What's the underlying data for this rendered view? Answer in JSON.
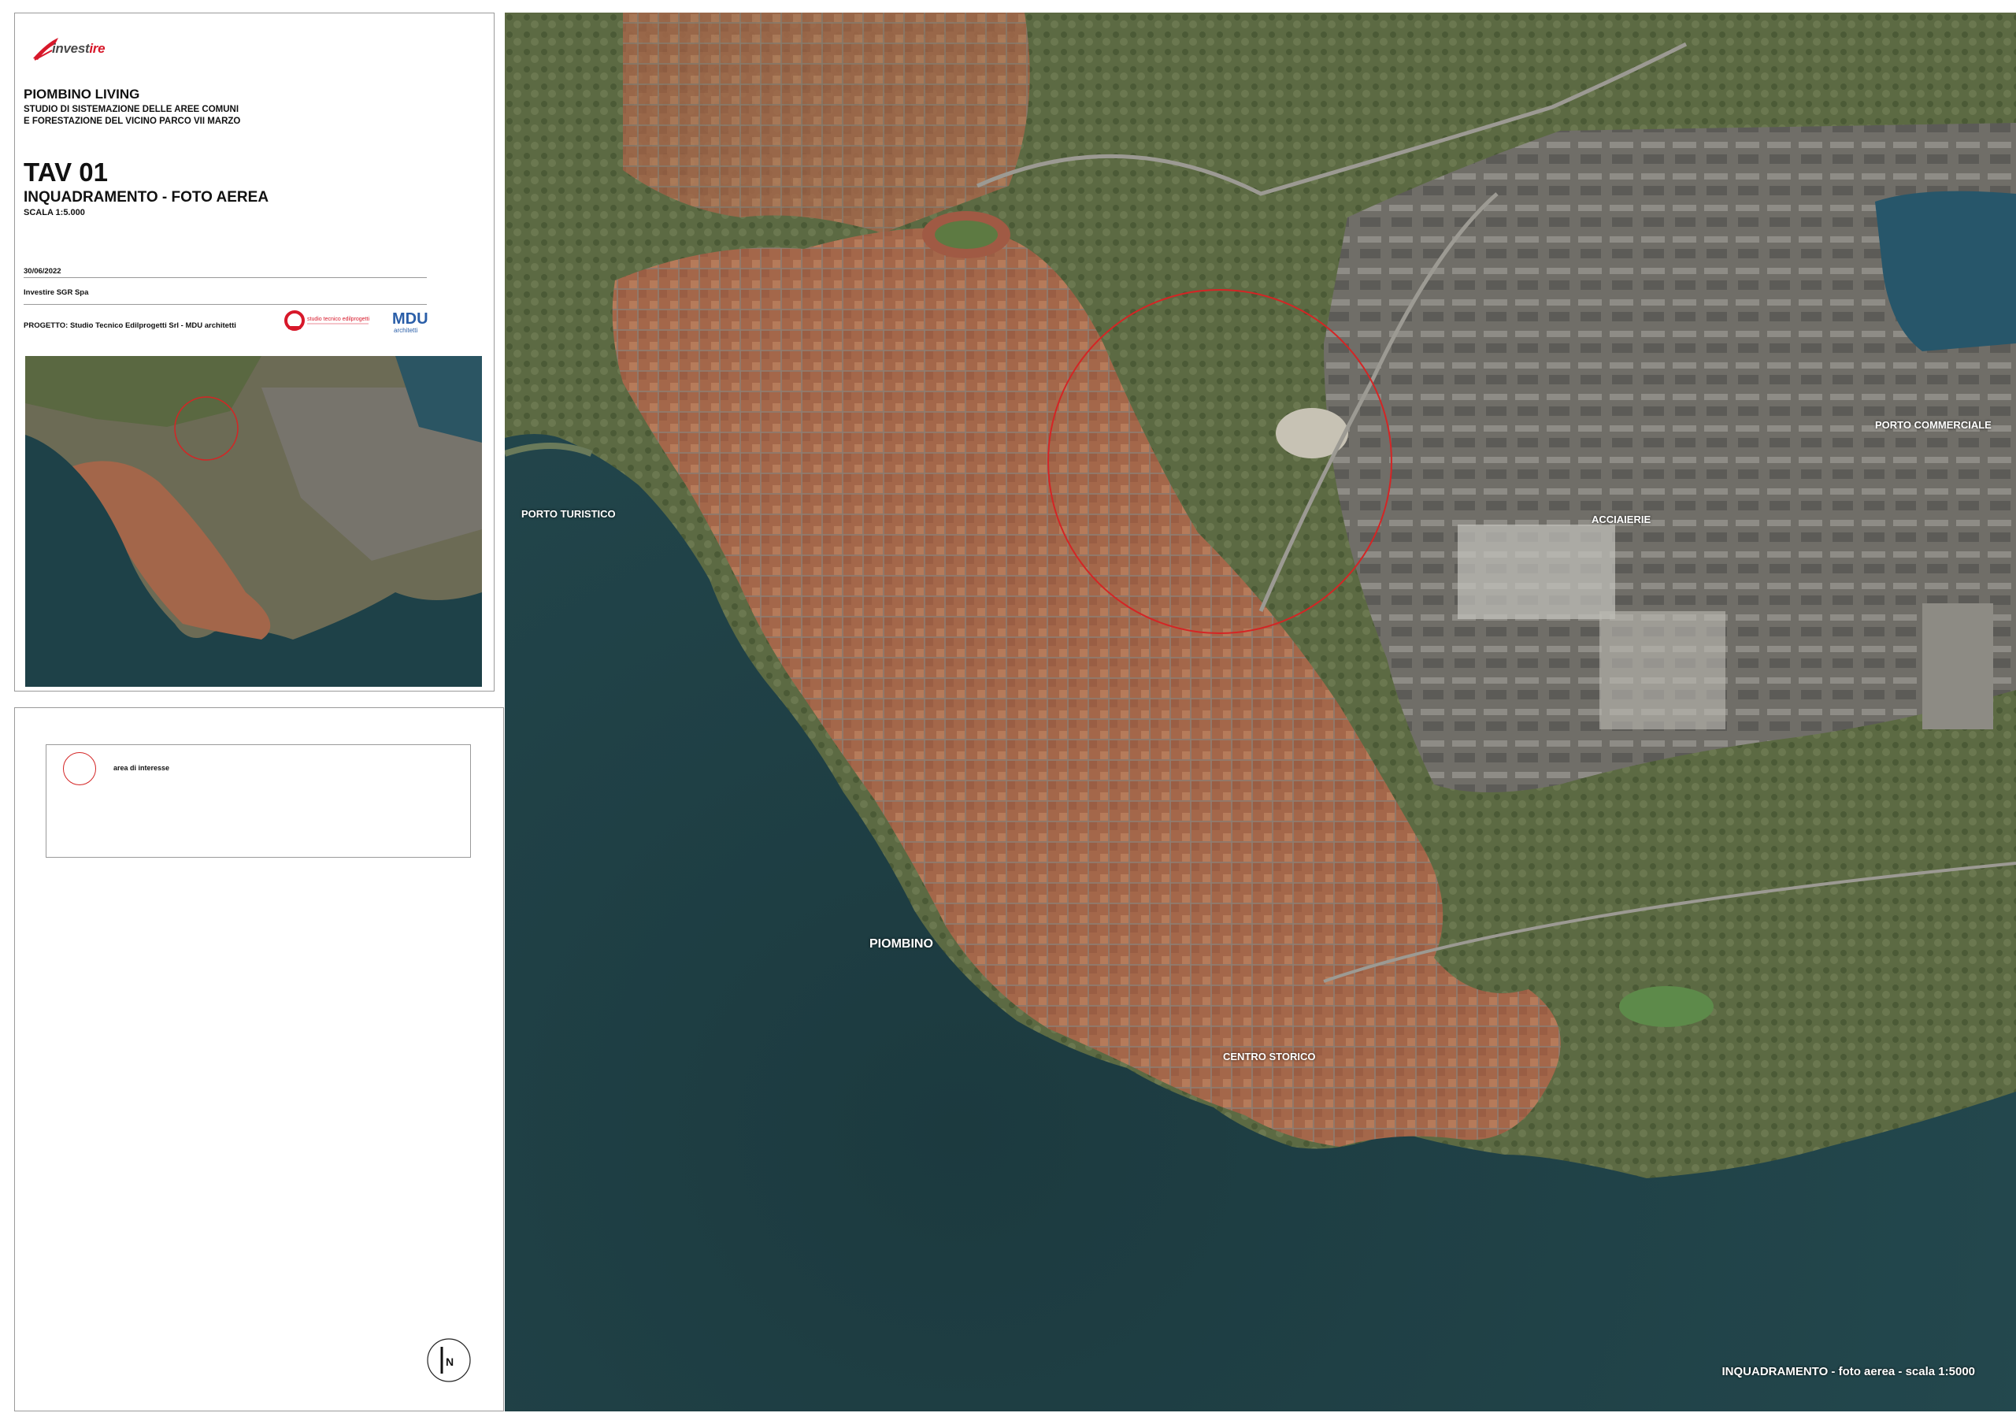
{
  "brand": {
    "logo_prefix": "invest",
    "logo_suffix": "ire",
    "accent": "#d7182a"
  },
  "header": {
    "project_title": "PIOMBINO LIVING",
    "project_subtitle_line1": "STUDIO DI SISTEMAZIONE DELLE AREE COMUNI",
    "project_subtitle_line2": "E FORESTAZIONE DEL VICINO PARCO VII MARZO",
    "tav": "TAV 01",
    "tav_subtitle": "INQUADRAMENTO - FOTO AEREA",
    "scale": "SCALA 1:5.000",
    "date": "30/06/2022",
    "client": "Investire SGR Spa",
    "progetto": "PROGETTO: Studio Tecnico Edilprogetti Srl - MDU architetti",
    "studio_logo_text": "studio tecnico edilprogetti",
    "mdu_logo_text": "MDU",
    "mdu_logo_sub": "architetti"
  },
  "legend": {
    "items": [
      {
        "label": "area di interesse",
        "color": "#d42525",
        "icon": "circle-outline-icon"
      }
    ]
  },
  "north_arrow": {
    "label": "N"
  },
  "map": {
    "labels": {
      "porto_turistico": "PORTO TURISTICO",
      "porto_commerciale": "PORTO COMMERCIALE",
      "acciaierie": "ACCIAIERIE",
      "piombino": "PIOMBINO",
      "centro_storico": "CENTRO STORICO"
    },
    "caption": "INQUADRAMENTO - foto aerea - scala 1:5000",
    "sea_color": "#1e4148",
    "urban_color": "#a86b4d",
    "vegetation_color": "#4e5f3a",
    "industrial_color": "#6b6a66"
  }
}
